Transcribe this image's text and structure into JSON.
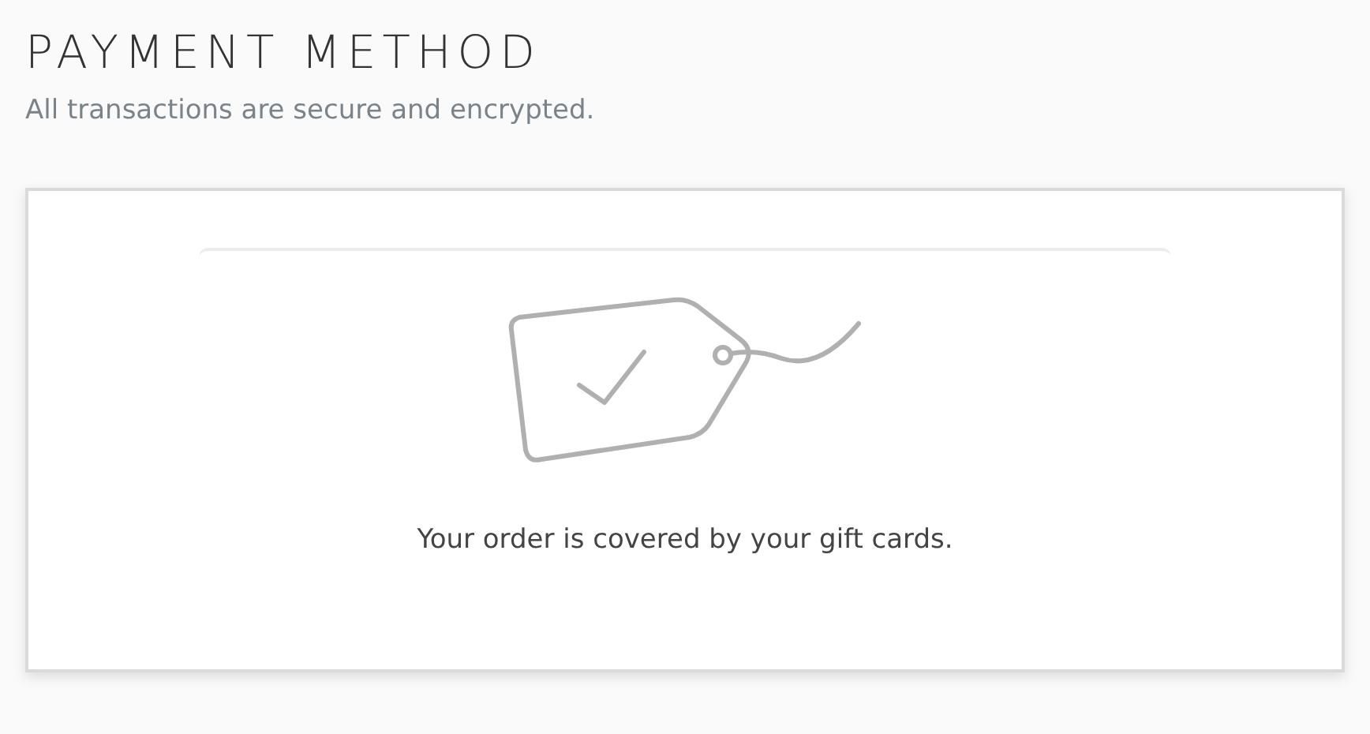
{
  "title": "PAYMENT METHOD",
  "subtitle": "All transactions are secure and encrypted.",
  "message": "Your order is covered by your gift cards."
}
